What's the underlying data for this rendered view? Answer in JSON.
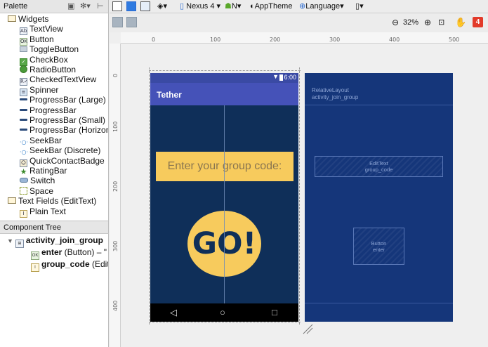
{
  "palette": {
    "title": "Palette",
    "items": [
      {
        "label": "Widgets",
        "icon": "folder-icon",
        "indent": 0
      },
      {
        "label": "TextView",
        "icon": "Ab",
        "indent": 1
      },
      {
        "label": "Button",
        "icon": "OK",
        "indent": 1
      },
      {
        "label": "ToggleButton",
        "icon": "toggle-icon",
        "indent": 1
      },
      {
        "label": "CheckBox",
        "icon": "checkbox-icon",
        "indent": 1
      },
      {
        "label": "RadioButton",
        "icon": "radio-icon",
        "indent": 1
      },
      {
        "label": "CheckedTextView",
        "icon": "R✔",
        "indent": 1
      },
      {
        "label": "Spinner",
        "icon": "spinner-icon",
        "indent": 1
      },
      {
        "label": "ProgressBar (Large)",
        "icon": "progress-icon",
        "indent": 1
      },
      {
        "label": "ProgressBar",
        "icon": "progress-icon",
        "indent": 1
      },
      {
        "label": "ProgressBar (Small)",
        "icon": "progress-icon",
        "indent": 1
      },
      {
        "label": "ProgressBar (Horizon",
        "icon": "progress-icon",
        "indent": 1
      },
      {
        "label": "SeekBar",
        "icon": "seekbar-icon",
        "indent": 1
      },
      {
        "label": "SeekBar (Discrete)",
        "icon": "seekbar-icon",
        "indent": 1
      },
      {
        "label": "QuickContactBadge",
        "icon": "contact-icon",
        "indent": 1
      },
      {
        "label": "RatingBar",
        "icon": "star-icon",
        "indent": 1
      },
      {
        "label": "Switch",
        "icon": "switch-icon",
        "indent": 1
      },
      {
        "label": "Space",
        "icon": "space-icon",
        "indent": 1
      },
      {
        "label": "Text Fields (EditText)",
        "icon": "folder-icon",
        "indent": 0
      },
      {
        "label": "Plain Text",
        "icon": "edittext-icon",
        "indent": 1
      }
    ]
  },
  "component_tree": {
    "title": "Component Tree",
    "root": {
      "label": "activity_join_group"
    },
    "children": [
      {
        "bold": "enter",
        "rest": " (Button) – \"",
        "icon": "OK"
      },
      {
        "bold": "group_code",
        "rest": " (Edit",
        "icon": "edittext-icon"
      }
    ]
  },
  "toolbar": {
    "device": "Nexus 4",
    "api": "N",
    "theme": "AppTheme",
    "language": "Language",
    "zoom": "32%",
    "warnings": "4"
  },
  "ruler": {
    "h": [
      "0",
      "100",
      "200",
      "300",
      "400",
      "500"
    ],
    "v": [
      "0",
      "100",
      "200",
      "300",
      "400"
    ]
  },
  "phone": {
    "time": "6:00",
    "app_title": "Tether",
    "hint": "Enter your group code:",
    "button": "GO!",
    "nav": [
      "◁",
      "○",
      "□"
    ]
  },
  "blueprint": {
    "layout_type": "RelativeLayout",
    "layout_id": "activity_join_group",
    "edit_type": "EditText",
    "edit_id": "group_code",
    "button_type": "Button",
    "button_id": "enter"
  },
  "colors": {
    "app_bar": "#4552b8",
    "status_bar": "#3a4aa4",
    "background": "#0f2f59",
    "accent": "#f7cb5d",
    "blueprint": "#15367a"
  }
}
